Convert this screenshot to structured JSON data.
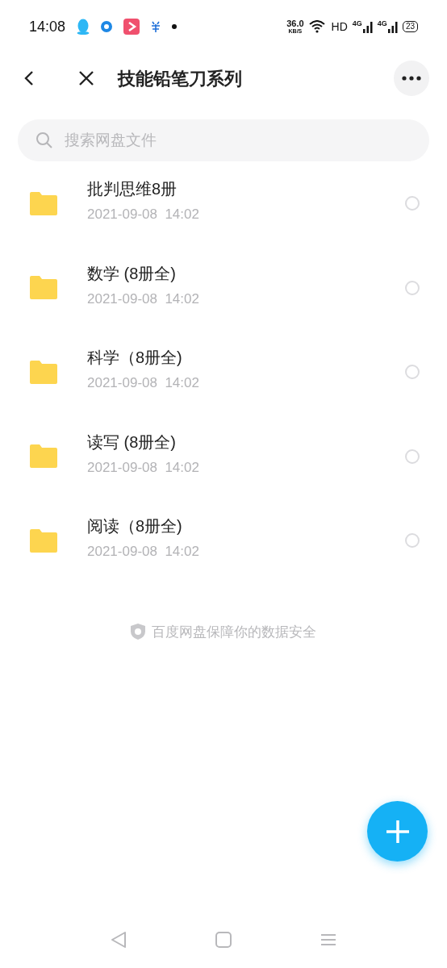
{
  "status_bar": {
    "time": "14:08",
    "speed_value": "36.0",
    "speed_unit": "KB/S",
    "hd": "HD",
    "network_1": "4G",
    "network_2": "4G",
    "battery": "23"
  },
  "header": {
    "title": "技能铅笔刀系列"
  },
  "search": {
    "placeholder": "搜索网盘文件"
  },
  "files": [
    {
      "name": "批判思维8册",
      "date": "2021-09-08  14:02",
      "selected": false
    },
    {
      "name": "数学 (8册全)",
      "date": "2021-09-08  14:02",
      "selected": false
    },
    {
      "name": "科学（8册全)",
      "date": "2021-09-08  14:02",
      "selected": false
    },
    {
      "name": "读写 (8册全)",
      "date": "2021-09-08  14:02",
      "selected": false
    },
    {
      "name": "阅读（8册全)",
      "date": "2021-09-08  14:02",
      "selected": false
    }
  ],
  "footer_note": "百度网盘保障你的数据安全"
}
